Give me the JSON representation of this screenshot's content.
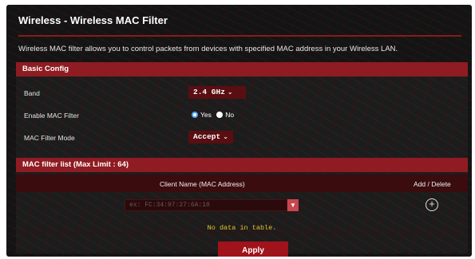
{
  "header": {
    "title": "Wireless - Wireless MAC Filter",
    "description": "Wireless MAC filter allows you to control packets from devices with specified MAC address in your Wireless LAN."
  },
  "basic_config": {
    "title": "Basic Config",
    "band": {
      "label": "Band",
      "value": "2.4 GHz"
    },
    "enable_mac_filter": {
      "label": "Enable MAC Filter",
      "options": [
        "Yes",
        "No"
      ],
      "selected": "Yes"
    },
    "mac_filter_mode": {
      "label": "MAC Filter Mode",
      "value": "Accept"
    }
  },
  "mac_filter_list": {
    "title": "MAC filter list (Max Limit : 64)",
    "columns": [
      "Client Name (MAC Address)",
      "Add / Delete"
    ],
    "input_placeholder": "ex: FC:34:97:27:6A:10",
    "empty_text": "No data in table."
  },
  "actions": {
    "apply_label": "Apply"
  },
  "colors": {
    "accent": "#8e1c22",
    "button": "#a0131a",
    "empty_text": "#e8c32a"
  },
  "icons": {
    "dropdown": "chevron-down-icon",
    "add": "plus-circle-icon"
  }
}
